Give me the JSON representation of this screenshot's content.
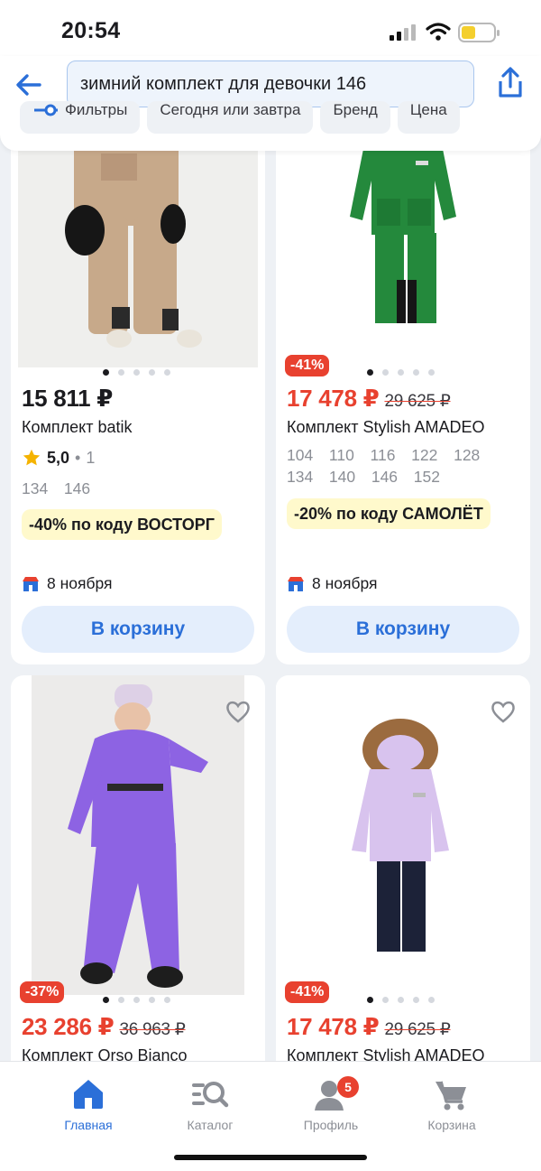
{
  "status_bar": {
    "time": "20:54"
  },
  "search": {
    "query": "зимний комплект для девочки 146"
  },
  "filters": [
    {
      "label": "Фильтры",
      "icon": "filter-icon"
    },
    {
      "label": "Сегодня или завтра"
    },
    {
      "label": "Бренд"
    },
    {
      "label": "Цена"
    }
  ],
  "products": [
    {
      "price": "15 811 ₽",
      "name": "Комплект batik",
      "rating": "5,0",
      "reviews": "1",
      "sizes": "134  146",
      "promo": "-40% по коду ВОСТОРГ",
      "delivery": "8 ноября",
      "button": "В корзину",
      "colors": {
        "outfit": "#c7a98a"
      }
    },
    {
      "discount": "-41%",
      "price": "17 478 ₽",
      "old_price": "29 625 ₽",
      "name": "Комплект Stylish AMADEO",
      "sizes": "104  110  116  122  128  134  140  146  152",
      "promo": "-20% по коду САМОЛЁТ",
      "delivery": "8 ноября",
      "button": "В корзину",
      "colors": {
        "outfit": "#24893c"
      }
    },
    {
      "discount": "-37%",
      "price": "23 286 ₽",
      "old_price": "36 963 ₽",
      "name": "Комплект Orso Bianco",
      "colors": {
        "outfit": "#8d63e3"
      }
    },
    {
      "discount": "-41%",
      "price": "17 478 ₽",
      "old_price": "29 625 ₽",
      "name": "Комплект Stylish AMADEO",
      "colors": {
        "outfit": "#d8c3ee",
        "pants": "#1c2238"
      }
    }
  ],
  "tabs": [
    {
      "label": "Главная",
      "icon": "home-icon",
      "active": true
    },
    {
      "label": "Каталог",
      "icon": "catalog-search-icon"
    },
    {
      "label": "Профиль",
      "icon": "profile-icon",
      "badge": "5"
    },
    {
      "label": "Корзина",
      "icon": "cart-icon"
    }
  ],
  "colors": {
    "accent": "#2b6fd8",
    "sale": "#e8412f",
    "promo_bg": "#fff9cc"
  }
}
